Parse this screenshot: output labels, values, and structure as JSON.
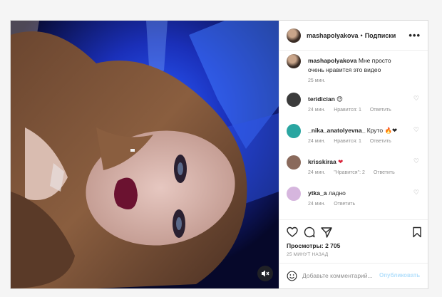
{
  "post": {
    "author": "mashapolyakova",
    "separator": "•",
    "follow_label": "Подписки",
    "more_icon": "more-icon",
    "caption": {
      "user": "mashapolyakova",
      "text": "Мне просто очень нравится это видео",
      "time": "25 мин."
    },
    "comments": [
      {
        "user": "teridician",
        "text": "",
        "emoji": "😍",
        "emoji_color": "#e8a43a",
        "time": "24 мин.",
        "likes": "Нравится: 1",
        "reply": "Ответить",
        "avatar_color": "#3b3b3b"
      },
      {
        "user": "_nika_anatolyevna_",
        "text": "Круто",
        "emoji": "🔥❤",
        "emoji_color": "#e85d28",
        "time": "24 мин.",
        "likes": "Нравится: 1",
        "reply": "Ответить",
        "avatar_color": "#2aa6a1"
      },
      {
        "user": "krisskiraa",
        "text": "",
        "emoji": "❤",
        "emoji_color": "#d9243a",
        "time": "24 мин.",
        "likes": "\"Нравится\": 2",
        "reply": "Ответить",
        "avatar_color": "#8a6a5c"
      },
      {
        "user": "ytka_a",
        "text": "ладно",
        "emoji": "",
        "emoji_color": "",
        "time": "24 мин.",
        "likes": "",
        "reply": "Ответить",
        "avatar_color": "#d6b6de"
      }
    ],
    "views_label": "Просмотры: 2 705",
    "time_ago": "25 МИНУТ НАЗАД",
    "comment_placeholder": "Добавьте комментарий...",
    "publish_label": "Опубликовать"
  },
  "colors": {
    "accent": "#0095f6",
    "publish_disabled": "#b2dffc",
    "muted_text": "#8e8e8e"
  }
}
